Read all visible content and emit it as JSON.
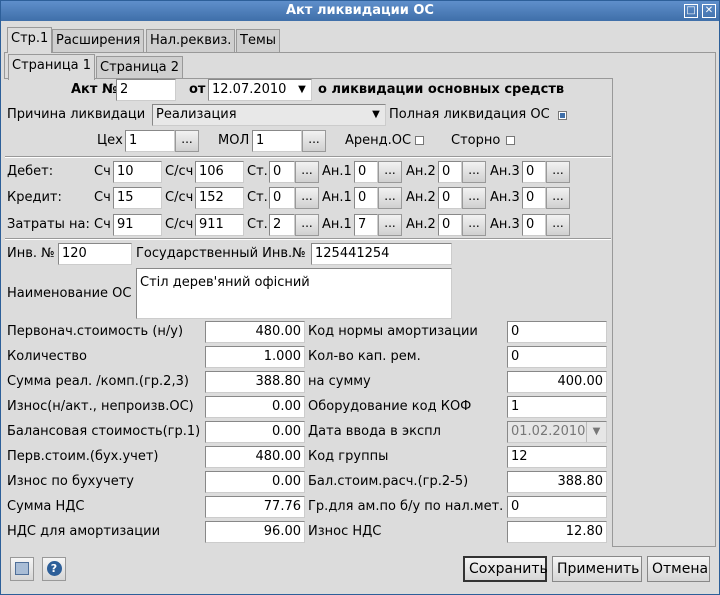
{
  "window": {
    "title": "Акт ликвидации ОС"
  },
  "tabs": [
    "Стр.1",
    "Расширения",
    "Нал.реквиз.",
    "Темы"
  ],
  "subtabs": [
    "Страница 1",
    "Страница 2"
  ],
  "header": {
    "act_no_label": "Акт №",
    "act_no": "2",
    "from_label": "от",
    "date": "12.07.2010",
    "about": "о ликвидации основных средств",
    "reason_label": "Причина ликвидаци",
    "reason": "Реализация",
    "full_label": "Полная ликвидация ОС",
    "dept_label": "Цех",
    "dept": "1",
    "mol_label": "МОЛ",
    "mol": "1",
    "rent_label": "Аренд.ОС",
    "storno_label": "Сторно",
    "ellipsis": "..."
  },
  "accounts": {
    "sch_label": "Сч",
    "ssch_label": "С/сч",
    "st_label": "Ст.",
    "an1_label": "Ан.1",
    "an2_label": "Ан.2",
    "an3_label": "Ан.3",
    "rows": [
      {
        "label": "Дебет:",
        "sch": "10",
        "ssch": "106",
        "st": "0",
        "an1": "0",
        "an2": "0",
        "an3": "0"
      },
      {
        "label": "Кредит:",
        "sch": "15",
        "ssch": "152",
        "st": "0",
        "an1": "0",
        "an2": "0",
        "an3": "0"
      },
      {
        "label": "Затраты на:",
        "sch": "91",
        "ssch": "911",
        "st": "2",
        "an1": "7",
        "an2": "0",
        "an3": "0"
      }
    ]
  },
  "asset": {
    "inv_label": "Инв. №",
    "inv": "120",
    "state_inv_label": "Государственный Инв.№",
    "state_inv": "125441254",
    "name_label": "Наименование ОС",
    "name": "Стіл дерев'яний офісний"
  },
  "left_fields": [
    {
      "label": "Первонач.стоимость (н/у)",
      "value": "480.00"
    },
    {
      "label": "Количество",
      "value": "1.000"
    },
    {
      "label": "Сумма реал. /комп.(гр.2,3)",
      "value": "388.80"
    },
    {
      "label": "Износ(н/акт., непроизв.ОС)",
      "value": "0.00"
    },
    {
      "label": "Балансовая стоимость(гр.1)",
      "value": "0.00"
    },
    {
      "label": "Перв.стоим.(бух.учет)",
      "value": "480.00"
    },
    {
      "label": "Износ по бухучету",
      "value": "0.00"
    },
    {
      "label": "Сумма НДС",
      "value": "77.76"
    },
    {
      "label": "НДС для амортизации",
      "value": "96.00"
    }
  ],
  "right_fields": [
    {
      "label": "Код нормы амортизации",
      "value": "0"
    },
    {
      "label": "Кол-во кап. рем.",
      "value": "0"
    },
    {
      "label": "на сумму",
      "value": "400.00"
    },
    {
      "label": "Оборудование код КОФ",
      "value": "1"
    },
    {
      "label": "Дата ввода в экспл",
      "value": "01.02.2010"
    },
    {
      "label": "Код группы",
      "value": "12"
    },
    {
      "label": "Бал.стоим.расч.(гр.2-5)",
      "value": "388.80"
    },
    {
      "label": "Гр.для ам.по б/у по нал.мет.",
      "value": "0"
    },
    {
      "label": "Износ НДС",
      "value": "12.80"
    }
  ],
  "buttons": {
    "save": "Сохранить",
    "apply": "Применить",
    "cancel": "Отмена"
  },
  "icons": {
    "print": "print-icon",
    "help": "help-icon"
  }
}
